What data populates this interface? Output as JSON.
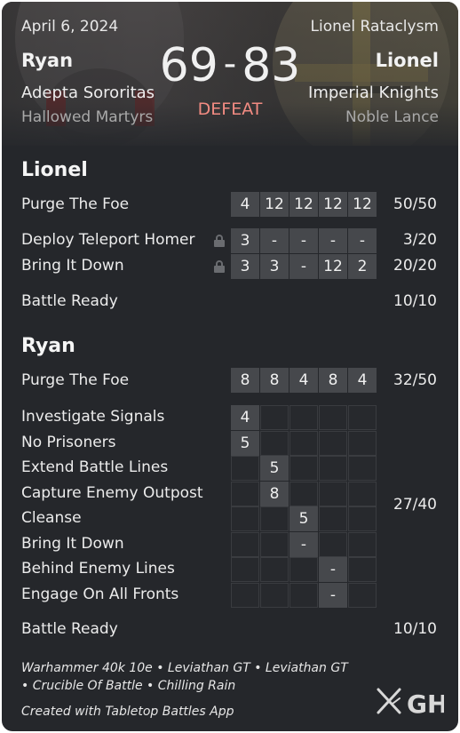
{
  "header": {
    "date": "April 6, 2024",
    "event": "Lionel Rataclysm",
    "player1": {
      "name": "Ryan",
      "faction": "Adepta Sororitas",
      "detachment": "Hallowed Martyrs",
      "score": "69"
    },
    "player2": {
      "name": "Lionel",
      "faction": "Imperial Knights",
      "detachment": "Noble Lance",
      "score": "83"
    },
    "separator": "-",
    "result": "DEFEAT"
  },
  "lionel": {
    "title": "Lionel",
    "primary": {
      "label": "Purge The Foe",
      "rounds": [
        "4",
        "12",
        "12",
        "12",
        "12"
      ],
      "total": "50/50"
    },
    "secondaries": [
      {
        "label": "Deploy Teleport Homer",
        "locked": true,
        "rounds": [
          "3",
          "-",
          "-",
          "-",
          "-"
        ],
        "total": "3/20"
      },
      {
        "label": "Bring It Down",
        "locked": true,
        "rounds": [
          "3",
          "3",
          "-",
          "12",
          "2"
        ],
        "total": "20/20"
      }
    ],
    "battle_ready": {
      "label": "Battle Ready",
      "total": "10/10"
    }
  },
  "ryan": {
    "title": "Ryan",
    "primary": {
      "label": "Purge The Foe",
      "rounds": [
        "8",
        "8",
        "4",
        "8",
        "4"
      ],
      "total": "32/50"
    },
    "secondaries": [
      {
        "label": "Investigate Signals",
        "round": 1,
        "value": "4"
      },
      {
        "label": "No Prisoners",
        "round": 1,
        "value": "5"
      },
      {
        "label": "Extend Battle Lines",
        "round": 2,
        "value": "5"
      },
      {
        "label": "Capture Enemy Outpost",
        "round": 2,
        "value": "8"
      },
      {
        "label": "Cleanse",
        "round": 3,
        "value": "5"
      },
      {
        "label": "Bring It Down",
        "round": 3,
        "value": "-"
      },
      {
        "label": "Behind Enemy Lines",
        "round": 4,
        "value": "-"
      },
      {
        "label": "Engage On All Fronts",
        "round": 4,
        "value": "-"
      }
    ],
    "secondary_total": "27/40",
    "battle_ready": {
      "label": "Battle Ready",
      "total": "10/10"
    }
  },
  "footer": {
    "line1": "Warhammer 40k 10e • Leviathan GT • Leviathan GT",
    "line2": "• Crucible Of Battle • Chilling Rain",
    "line3": "Created with Tabletop Battles App",
    "logo_text": "GH",
    "logo_icon": "crossed-swords-icon"
  },
  "colors": {
    "card": "#25272b",
    "cell": "#46484c",
    "result": "#f28b82"
  }
}
